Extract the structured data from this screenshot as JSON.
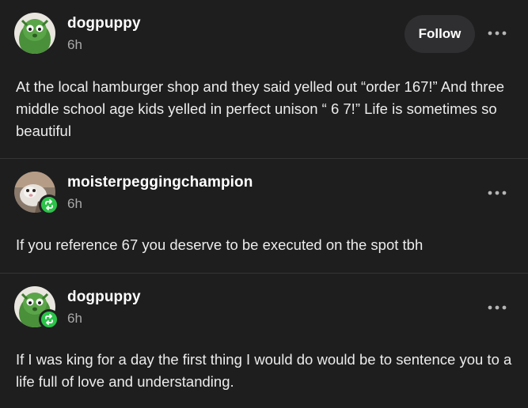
{
  "posts": [
    {
      "username": "dogpuppy",
      "timestamp": "6h",
      "follow_label": "Follow",
      "body": "At the local hamburger shop and they said yelled out “order 167!” And three middle school age kids yelled in perfect unison “ 6 7!” Life is sometimes so beautiful",
      "avatar": "green-cartoon-avatar",
      "reblog_badge": false
    },
    {
      "username": "moisterpeggingchampion",
      "timestamp": "6h",
      "body": "If you reference 67 you deserve to be executed on the spot tbh",
      "avatar": "pet-photo-avatar",
      "reblog_badge": true
    },
    {
      "username": "dogpuppy",
      "timestamp": "6h",
      "body": "If I was king for a day the first thing I would do would be to sentence you to a life full of love and understanding.",
      "avatar": "green-cartoon-avatar",
      "reblog_badge": true
    }
  ],
  "colors": {
    "background": "#1e1e1f",
    "badge": "#2bc349",
    "follow_button": "#2f2f31",
    "muted_text": "#a9a9a9"
  },
  "icons": {
    "more": "more-options-icon",
    "reblog": "reblog-icon"
  }
}
